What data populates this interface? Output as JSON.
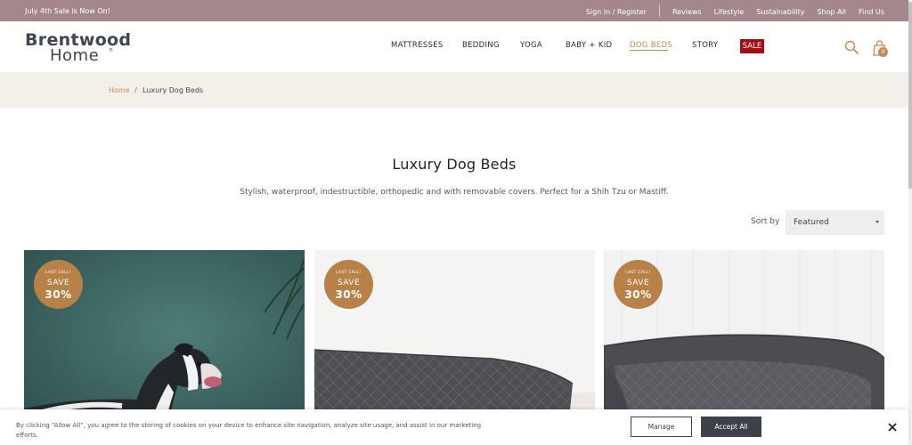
{
  "topbar": {
    "promo": "July 4th Sale is Now On!",
    "links": [
      "Sign In / Register",
      "Reviews",
      "Lifestyle",
      "Sustainability",
      "Shop All",
      "Find Us"
    ]
  },
  "brand": {
    "line1": "Brentwood",
    "line2": "Home",
    "mark": "®"
  },
  "nav": {
    "items": [
      "MATTRESSES",
      "BEDDING",
      "YOGA",
      "BABY + KID",
      "DOG BEDS",
      "STORY"
    ],
    "sale": "SALE",
    "active": "DOG BEDS"
  },
  "icons": {
    "search": "search-icon",
    "cart": "shopping-bag-icon",
    "close": "close-icon"
  },
  "cart": {
    "count": "0"
  },
  "breadcrumb": {
    "home": "Home",
    "separator": "/",
    "current": "Luxury Dog Beds"
  },
  "page": {
    "title": "Luxury Dog Beds",
    "description": "Stylish, waterproof, indestructible, orthopedic and with removable covers. Perfect for a Shih Tzu or Mastiff."
  },
  "sort": {
    "label": "Sort by",
    "value": "Featured"
  },
  "products": [
    {
      "badge": {
        "line1": "LAST CALL!",
        "line2": "SAVE",
        "line3": "30%"
      }
    },
    {
      "badge": {
        "line1": "LAST CALL!",
        "line2": "SAVE",
        "line3": "30%"
      }
    },
    {
      "badge": {
        "line1": "LAST CALL!",
        "line2": "SAVE",
        "line3": "30%"
      }
    }
  ],
  "cookie": {
    "text": "By clicking “Allow All”, you agree to the storing of cookies on your device to enhance site navigation, analyze site usage, and assist in our marketing efforts.",
    "manage": "Manage",
    "allow": "Accept All"
  },
  "colors": {
    "topbar": "#a4878b",
    "accent": "#c48a55",
    "sale": "#a30e14",
    "breadcrumb_bg": "#f3efe9",
    "badge": "#b88147",
    "cookie_button": "#3c414a"
  }
}
